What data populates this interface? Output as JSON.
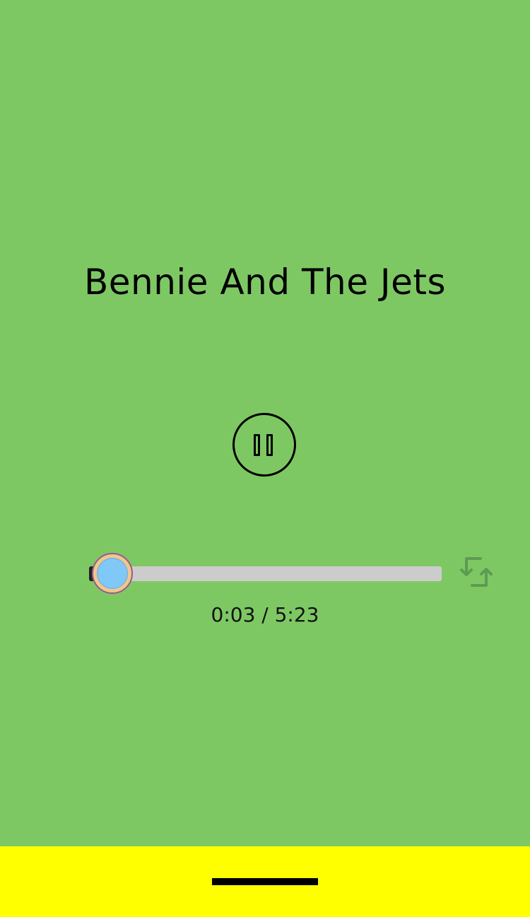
{
  "player": {
    "song_title": "Bennie And The Jets",
    "elapsed": "0:03",
    "duration": "5:23",
    "time_display": "0:03 / 5:23",
    "progress_fraction": 0.009,
    "pause_icon": "pause-icon",
    "repeat_icon": "repeat-icon"
  },
  "colors": {
    "background": "#7ec864",
    "bottom_bar": "#ffff00",
    "track": "#cccccc",
    "repeat_icon": "#5f9a52"
  }
}
